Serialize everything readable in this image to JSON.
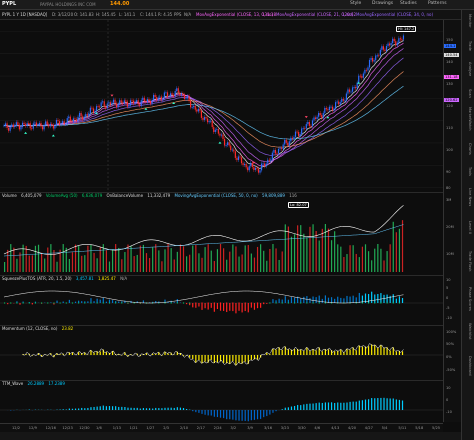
{
  "toolbar": {
    "symbol": "PYPL",
    "description": "PAYPAL HOLDINGS INC COM",
    "price": "144.00",
    "style": "Style",
    "drawings": "Drawings",
    "studies": "Studies",
    "patterns": "Patterns"
  },
  "studybar": {
    "title": "PYPL 1 Y 1D [NASDAQ]",
    "items": [
      "D: 3/12/20",
      "O: 141.83",
      "H: 145.45",
      "L: 141.1",
      "C: 144.1",
      "R: 4.35",
      "PPS",
      "N/A",
      "MovAvgExponential (CLOSE, 13, 0, no)",
      "131.18",
      "MovAvgExponential (CLOSE, 21, 0, no)",
      "120.62",
      "MovAvgExponential (CLOSE, 34, 0, no)"
    ]
  },
  "price_panel": {
    "callout_high": "Hi: 147.2",
    "callout_low": "Lo: 82.07",
    "yticks": [
      "150",
      "140",
      "130",
      "120",
      "110",
      "100",
      "90",
      "80"
    ],
    "last_price_tag": "144.1",
    "tag2": "140.54",
    "tag3": "131.18",
    "tag4": "120.62"
  },
  "volume_panel": {
    "labels": [
      "Volume",
      "6,405,079",
      "VolumeAvg (50)",
      "6,636,079",
      "OnBalanceVolume",
      "11,332,479",
      "MovingAvgExponential (CLOSE, 50, 0, no)",
      "59,809,889",
      "116"
    ],
    "yticks": [
      "3M",
      "20M",
      "10M"
    ]
  },
  "squeeze_panel": {
    "labels": [
      "SqueezePlusTOS (ATR, 20, 1.5, 20)",
      "3,457.81",
      "1,825.47",
      "N/A"
    ],
    "yticks": [
      "10",
      "5",
      "0",
      "-5",
      "-10"
    ]
  },
  "momentum_panel": {
    "labels": [
      "Momentum (12, CLOSE, no)",
      "23.82"
    ],
    "yticks": [
      "100%",
      "50%",
      "0%",
      "-50%"
    ]
  },
  "ttm_panel": {
    "labels": [
      "TTM_Wave",
      "26.2889",
      "17.2389"
    ],
    "yticks": [
      "10",
      "0",
      "-10"
    ]
  },
  "xaxis": [
    "12/2",
    "12/9",
    "12/16",
    "12/23",
    "12/30",
    "1/6",
    "1/13",
    "1/21",
    "1/27",
    "2/3",
    "2/10",
    "2/17",
    "2/24",
    "3/2",
    "3/9",
    "3/16",
    "3/23",
    "3/30",
    "4/6",
    "4/13",
    "4/20",
    "4/27",
    "5/4",
    "5/11",
    "5/18",
    "5/25"
  ],
  "sidebar": [
    "Monitor",
    "Trade",
    "Analyze",
    "Scan",
    "MarketWatch",
    "Charts",
    "Tools",
    "Live News",
    "Level II",
    "Trade Flash",
    "Phase Scores",
    "Watchlist",
    "Dashboard"
  ],
  "colors": {
    "up": "#2a6cff",
    "down": "#ff2a2a",
    "ema_fast": "#ffffff",
    "accent": "#ff9900"
  },
  "chart_data": {
    "type": "candlestick",
    "categories": [
      "12/2",
      "12/9",
      "12/16",
      "12/23",
      "12/30",
      "1/6",
      "1/13",
      "1/21",
      "1/27",
      "2/3",
      "2/10",
      "2/17",
      "2/24",
      "3/2",
      "3/9",
      "3/16",
      "3/23",
      "3/30",
      "4/6",
      "4/13",
      "4/20",
      "4/27",
      "5/4",
      "5/11",
      "5/18",
      "5/25"
    ],
    "close": [
      107,
      108,
      108,
      108,
      110,
      112,
      117,
      118,
      118,
      119,
      121,
      123,
      115,
      108,
      99,
      90,
      88,
      96,
      102,
      108,
      114,
      118,
      126,
      137,
      144,
      147
    ]
  }
}
